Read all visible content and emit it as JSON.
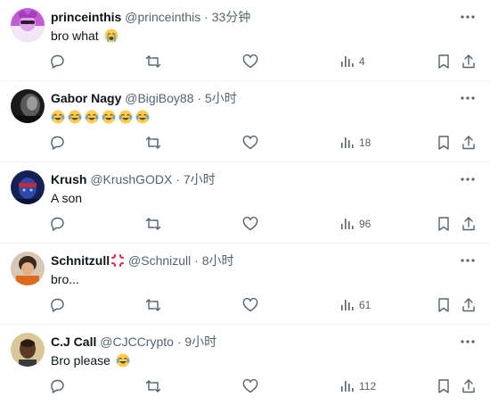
{
  "tweets": [
    {
      "name": "princeinthis",
      "handle": "@princeinthis",
      "dot": "·",
      "time": "33分钟",
      "text": "bro what",
      "emojis": [
        "loudly-crying-face"
      ],
      "views": "4",
      "avatar_color": "#c25bd6"
    },
    {
      "name": "Gabor Nagy",
      "handle": "@BigiBoy88",
      "dot": "·",
      "time": "5小时",
      "text": "",
      "emojis": [
        "face-with-tears-of-joy",
        "face-with-tears-of-joy",
        "face-with-tears-of-joy",
        "face-with-tears-of-joy",
        "face-with-tears-of-joy",
        "face-with-tears-of-joy"
      ],
      "views": "18",
      "avatar_color": "#2a2a2a"
    },
    {
      "name": "Krush",
      "handle": "@KrushGODX",
      "dot": "·",
      "time": "7小时",
      "text": "A son",
      "emojis": [],
      "views": "96",
      "avatar_color": "#1d2a6b"
    },
    {
      "name": "Schnitzull",
      "name_emoji": "anger-symbol",
      "handle": "@Schnizull",
      "dot": "·",
      "time": "8小时",
      "text": "bro...",
      "emojis": [],
      "views": "61",
      "avatar_color": "#8a4a2a"
    },
    {
      "name": "C.J Call",
      "handle": "@CJCCrypto",
      "dot": "·",
      "time": "9小时",
      "text": "Bro please",
      "emojis": [
        "face-with-tears-of-joy"
      ],
      "views": "112",
      "avatar_color": "#c8b48a"
    }
  ],
  "icons": {
    "more": "more-icon",
    "reply": "reply-icon",
    "retweet": "retweet-icon",
    "like": "heart-icon",
    "views": "views-icon",
    "bookmark": "bookmark-icon",
    "share": "share-icon"
  },
  "colors": {
    "text": "#0f1419",
    "secondary": "#536471",
    "divider": "#eff3f4",
    "emoji_yellow": "#ffcc4d",
    "tear_blue": "#5dadec"
  }
}
